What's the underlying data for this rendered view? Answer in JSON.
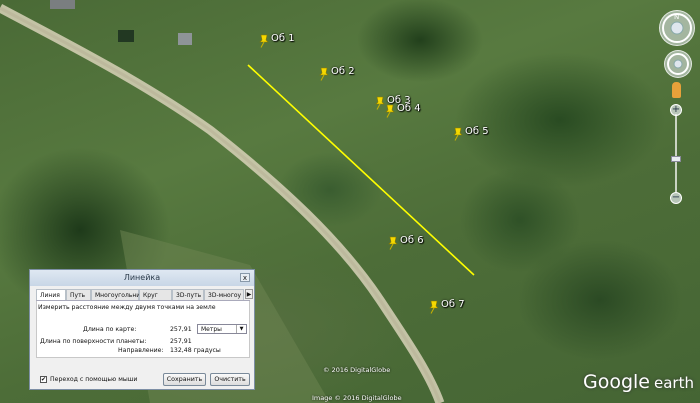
{
  "map": {
    "markers": [
      {
        "id": "ob1",
        "label": "Об 1"
      },
      {
        "id": "ob2",
        "label": "Об 2"
      },
      {
        "id": "ob3",
        "label": "Об 3"
      },
      {
        "id": "ob4",
        "label": "Об 4"
      },
      {
        "id": "ob5",
        "label": "Об 5"
      },
      {
        "id": "ob6",
        "label": "Об 6"
      },
      {
        "id": "ob7",
        "label": "Об 7"
      }
    ],
    "measure_line_color": "#ffff00",
    "marker_color": "#f5d800",
    "copyright_top": "© 2016 DigitalGlobe",
    "copyright_bottom": "Image © 2016 DigitalGlobe"
  },
  "logo": {
    "brand": "Google",
    "product": "earth"
  },
  "ruler": {
    "title": "Линейка",
    "close": "x",
    "tabs": [
      "Линия",
      "Путь",
      "Многоугольник",
      "Круг",
      "3D-путь",
      "3D-многоу"
    ],
    "tabs_arrow": "▶",
    "description": "Измерить расстояние между двумя точками на земле",
    "map_length_label": "Длина по карте:",
    "map_length_value": "257,91",
    "unit": "Метры",
    "surface_length_label": "Длина по поверхности планеты:",
    "surface_length_value": "257,91",
    "heading_label": "Направление:",
    "heading_value": "132,48 градусы",
    "mouse_nav_label": "Переход с помощью мыши",
    "mouse_nav_checked": "✔",
    "save_button": "Сохранить",
    "clear_button": "Очистить"
  }
}
